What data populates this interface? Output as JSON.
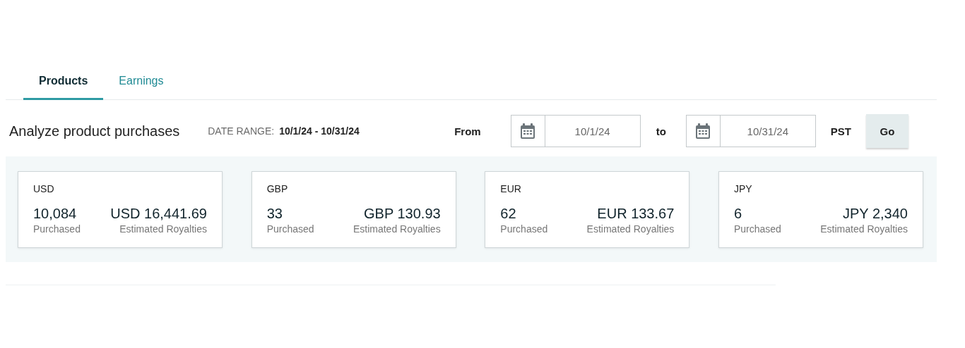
{
  "tabs": [
    {
      "label": "Products",
      "selected": true
    },
    {
      "label": "Earnings",
      "selected": false
    }
  ],
  "header": {
    "title": "Analyze product purchases",
    "range_label": "DATE RANGE:",
    "range_value": "10/1/24 - 10/31/24",
    "from_label": "From",
    "from_value": "10/1/24",
    "to_label": "to",
    "to_value": "10/31/24",
    "timezone": "PST",
    "go_button": "Go"
  },
  "cards": [
    {
      "currency": "USD",
      "count": "10,084",
      "count_label": "Purchased",
      "amount": "USD 16,441.69",
      "amount_label": "Estimated Royalties"
    },
    {
      "currency": "GBP",
      "count": "33",
      "count_label": "Purchased",
      "amount": "GBP 130.93",
      "amount_label": "Estimated Royalties"
    },
    {
      "currency": "EUR",
      "count": "62",
      "count_label": "Purchased",
      "amount": "EUR 133.67",
      "amount_label": "Estimated Royalties"
    },
    {
      "currency": "JPY",
      "count": "6",
      "count_label": "Purchased",
      "amount": "JPY 2,340",
      "amount_label": "Estimated Royalties"
    }
  ]
}
